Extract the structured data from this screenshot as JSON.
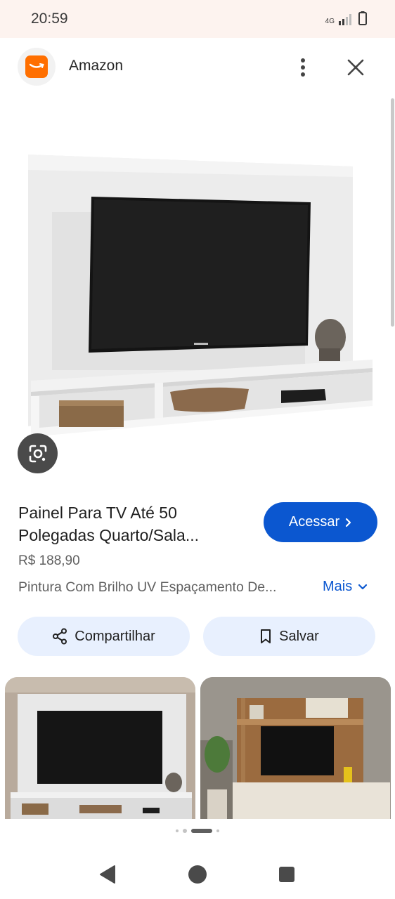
{
  "status_bar": {
    "time": "20:59",
    "network": "4G",
    "icons": [
      "signal-icon",
      "battery-icon"
    ]
  },
  "header": {
    "site_name": "Amazon",
    "logo_icon": "amazon-logo-icon",
    "menu_icon": "more-vert-icon",
    "close_icon": "close-icon"
  },
  "product": {
    "title": "Painel Para TV Até 50 Polegadas Quarto/Sala...",
    "price": "R$ 188,90",
    "description": "Pintura Com Brilho UV Espaçamento De...",
    "more_label": "Mais",
    "visit_label": "Acessar"
  },
  "actions": {
    "share_label": "Compartilhar",
    "save_label": "Salvar"
  },
  "colors": {
    "accent": "#0b57d0",
    "chip_bg": "#e8f0fe",
    "brand_orange": "#ff6f00",
    "status_bg": "#fdf3ef"
  },
  "carousel": {
    "total_dots": 4,
    "active_index": 2
  },
  "nav": {
    "back_icon": "back-triangle-icon",
    "home_icon": "home-circle-icon",
    "recents_icon": "recents-square-icon"
  }
}
